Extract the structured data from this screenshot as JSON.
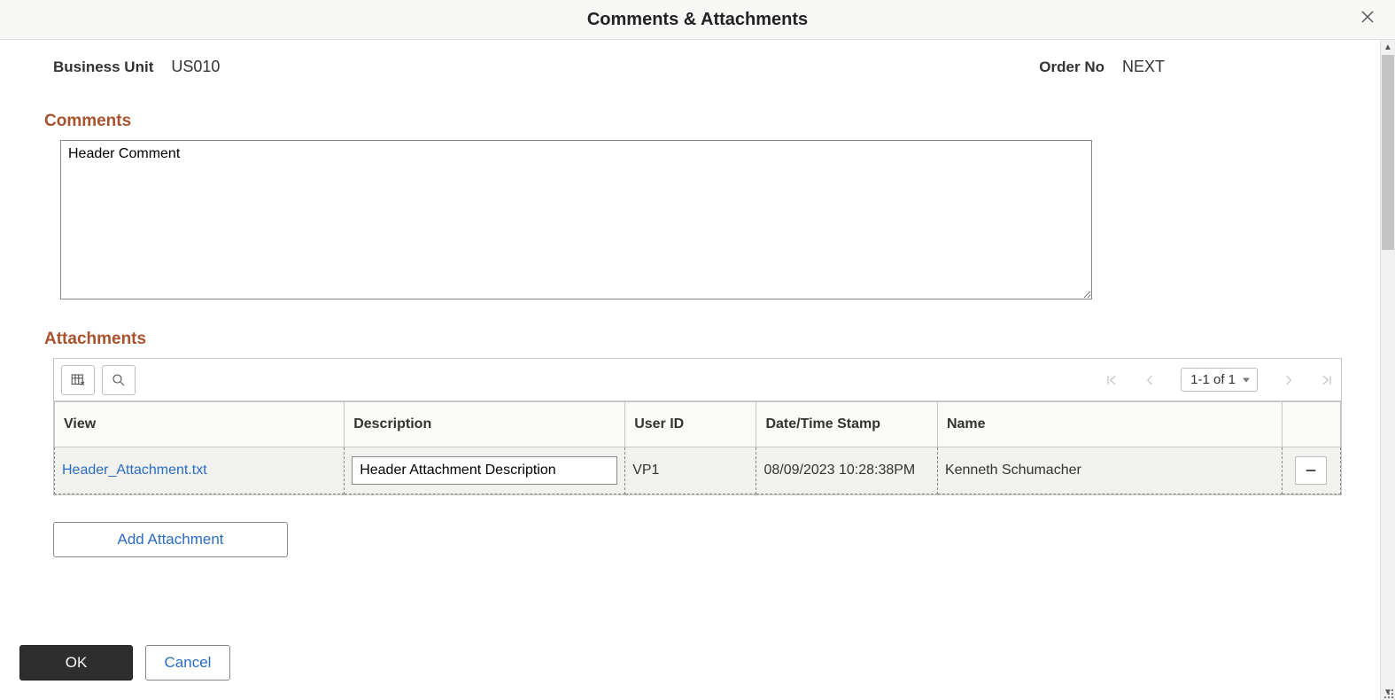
{
  "header": {
    "title": "Comments & Attachments"
  },
  "info": {
    "bu_label": "Business Unit",
    "bu_value": "US010",
    "order_label": "Order No",
    "order_value": "NEXT"
  },
  "sections": {
    "comments_heading": "Comments",
    "attachments_heading": "Attachments"
  },
  "comments": {
    "value": "Header Comment"
  },
  "grid": {
    "range_label": "1-1 of 1",
    "columns": {
      "view": "View",
      "description": "Description",
      "user_id": "User ID",
      "datetime": "Date/Time Stamp",
      "name": "Name"
    },
    "rows": [
      {
        "file": "Header_Attachment.txt",
        "description": "Header Attachment Description",
        "user_id": "VP1",
        "datetime": "08/09/2023 10:28:38PM",
        "name": "Kenneth Schumacher"
      }
    ]
  },
  "buttons": {
    "add_attachment": "Add Attachment",
    "ok": "OK",
    "cancel": "Cancel"
  }
}
